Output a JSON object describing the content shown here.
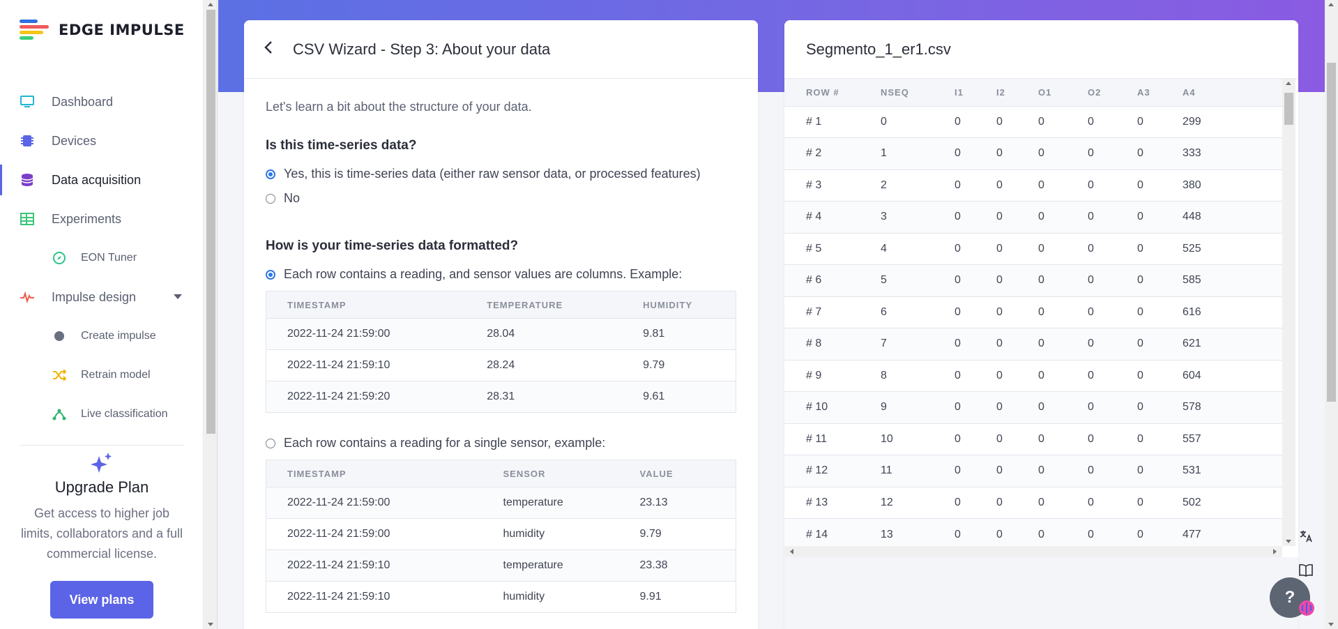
{
  "app": {
    "brand": "EDGE IMPULSE"
  },
  "sidebar": {
    "items": [
      {
        "label": "Dashboard",
        "icon": "monitor-icon"
      },
      {
        "label": "Devices",
        "icon": "chip-icon"
      },
      {
        "label": "Data acquisition",
        "icon": "database-icon",
        "active": true
      },
      {
        "label": "Experiments",
        "icon": "table-icon"
      },
      {
        "label": "EON Tuner",
        "icon": "compass-icon"
      },
      {
        "label": "Impulse design",
        "icon": "pulse-icon"
      },
      {
        "label": "Create impulse",
        "icon": "dot-icon"
      },
      {
        "label": "Retrain model",
        "icon": "shuffle-icon"
      },
      {
        "label": "Live classification",
        "icon": "network-icon"
      }
    ],
    "upgrade": {
      "title": "Upgrade Plan",
      "description": "Get access to higher job limits, collaborators and a full commercial license.",
      "button": "View plans"
    }
  },
  "wizard": {
    "title": "CSV Wizard - Step 3: About your data",
    "intro": "Let's learn a bit about the structure of your data.",
    "q1": "Is this time-series data?",
    "q1_yes": "Yes, this is time-series data (either raw sensor data, or processed features)",
    "q1_no": "No",
    "q2": "How is your time-series data formatted?",
    "q2_opt1": "Each row contains a reading, and sensor values are columns. Example:",
    "q2_opt2": "Each row contains a reading for a single sensor, example:",
    "table1": {
      "headers": [
        "TIMESTAMP",
        "TEMPERATURE",
        "HUMIDITY"
      ],
      "rows": [
        [
          "2022-11-24 21:59:00",
          "28.04",
          "9.81"
        ],
        [
          "2022-11-24 21:59:10",
          "28.24",
          "9.79"
        ],
        [
          "2022-11-24 21:59:20",
          "28.31",
          "9.61"
        ]
      ]
    },
    "table2": {
      "headers": [
        "TIMESTAMP",
        "SENSOR",
        "VALUE"
      ],
      "rows": [
        [
          "2022-11-24 21:59:00",
          "temperature",
          "23.13"
        ],
        [
          "2022-11-24 21:59:00",
          "humidity",
          "9.79"
        ],
        [
          "2022-11-24 21:59:10",
          "temperature",
          "23.38"
        ],
        [
          "2022-11-24 21:59:10",
          "humidity",
          "9.91"
        ]
      ]
    }
  },
  "file": {
    "title": "Segmento_1_er1.csv",
    "headers": [
      "ROW #",
      "NSEQ",
      "I1",
      "I2",
      "O1",
      "O2",
      "A3",
      "A4"
    ],
    "rows": [
      [
        "# 1",
        "0",
        "0",
        "0",
        "0",
        "0",
        "0",
        "299"
      ],
      [
        "# 2",
        "1",
        "0",
        "0",
        "0",
        "0",
        "0",
        "333"
      ],
      [
        "# 3",
        "2",
        "0",
        "0",
        "0",
        "0",
        "0",
        "380"
      ],
      [
        "# 4",
        "3",
        "0",
        "0",
        "0",
        "0",
        "0",
        "448"
      ],
      [
        "# 5",
        "4",
        "0",
        "0",
        "0",
        "0",
        "0",
        "525"
      ],
      [
        "# 6",
        "5",
        "0",
        "0",
        "0",
        "0",
        "0",
        "585"
      ],
      [
        "# 7",
        "6",
        "0",
        "0",
        "0",
        "0",
        "0",
        "616"
      ],
      [
        "# 8",
        "7",
        "0",
        "0",
        "0",
        "0",
        "0",
        "621"
      ],
      [
        "# 9",
        "8",
        "0",
        "0",
        "0",
        "0",
        "0",
        "604"
      ],
      [
        "# 10",
        "9",
        "0",
        "0",
        "0",
        "0",
        "0",
        "578"
      ],
      [
        "# 11",
        "10",
        "0",
        "0",
        "0",
        "0",
        "0",
        "557"
      ],
      [
        "# 12",
        "11",
        "0",
        "0",
        "0",
        "0",
        "0",
        "531"
      ],
      [
        "# 13",
        "12",
        "0",
        "0",
        "0",
        "0",
        "0",
        "502"
      ],
      [
        "# 14",
        "13",
        "0",
        "0",
        "0",
        "0",
        "0",
        "477"
      ]
    ]
  },
  "floating": {
    "help_label": "?"
  },
  "colors": {
    "accent": "#5b64e6",
    "radio": "#2e77e6",
    "hero_start": "#5b70e4",
    "hero_end": "#8a5be2"
  }
}
